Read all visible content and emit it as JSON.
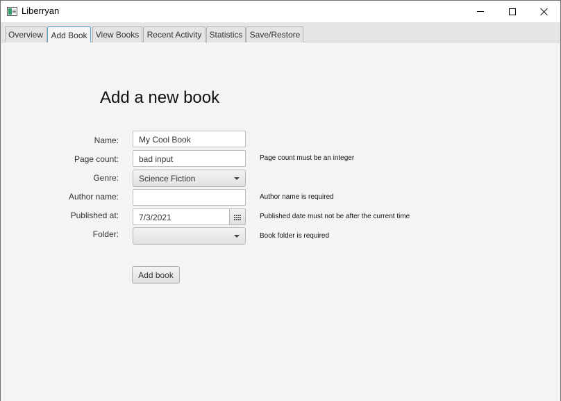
{
  "window": {
    "title": "Liberryan"
  },
  "tabs": [
    {
      "label": "Overview"
    },
    {
      "label": "Add Book"
    },
    {
      "label": "View Books"
    },
    {
      "label": "Recent Activity"
    },
    {
      "label": "Statistics"
    },
    {
      "label": "Save/Restore"
    }
  ],
  "active_tab": "Add Book",
  "form": {
    "heading": "Add a new book",
    "name": {
      "label": "Name:",
      "value": "My Cool Book"
    },
    "page_count": {
      "label": "Page count:",
      "value": "bad input",
      "error": "Page count must be an integer"
    },
    "genre": {
      "label": "Genre:",
      "value": "Science Fiction"
    },
    "author": {
      "label": "Author name:",
      "value": "",
      "error": "Author name is required"
    },
    "published": {
      "label": "Published at:",
      "value": "7/3/2021",
      "error": "Published date must not be after the current time"
    },
    "folder": {
      "label": "Folder:",
      "value": "",
      "error": "Book folder is required"
    },
    "submit_label": "Add book"
  },
  "icons": {
    "app": "app-icon",
    "minimize": "minimize-icon",
    "maximize": "maximize-icon",
    "close": "close-icon",
    "calendar": "calendar-icon",
    "dropdown": "chevron-down-icon"
  },
  "colors": {
    "active_tab_border": "#5aa4d6",
    "background": "#f4f4f4"
  }
}
